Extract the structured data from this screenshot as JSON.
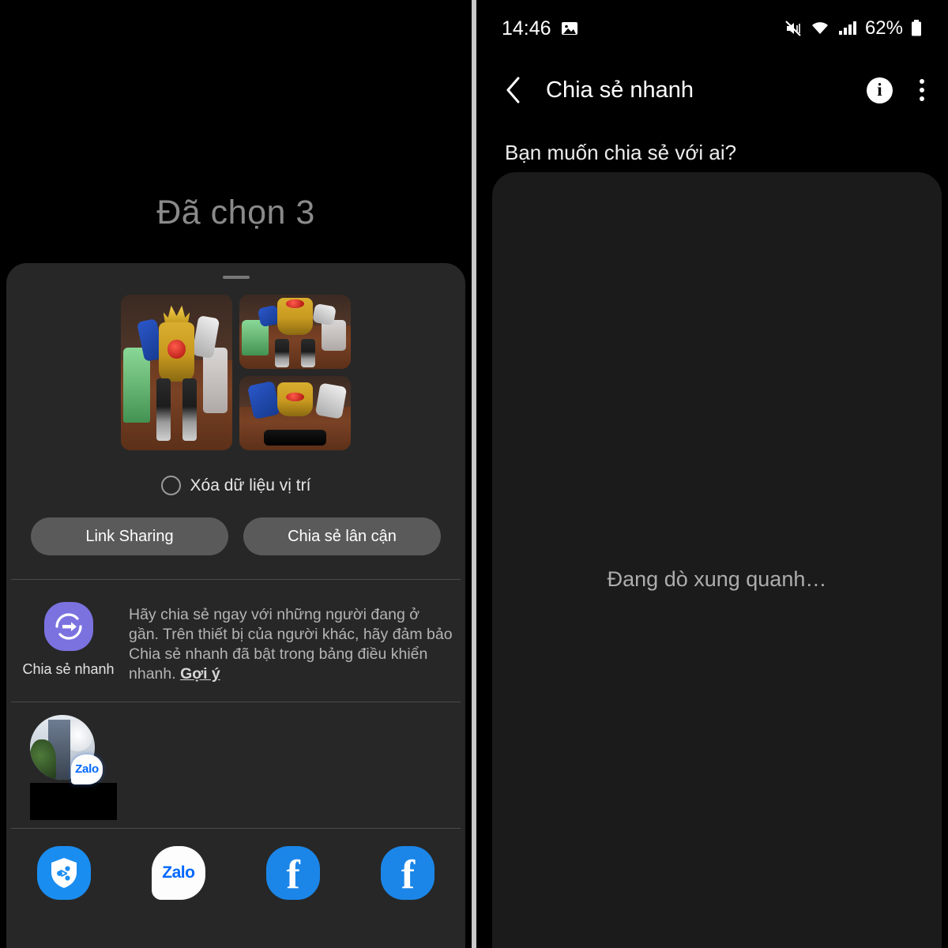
{
  "left_screen": {
    "selected_title": "Đã chọn 3",
    "thumbnails": [
      {
        "name": "robot-photo-1",
        "alt": "Toy robot figure full body on wooden floor"
      },
      {
        "name": "robot-photo-2",
        "alt": "Toy robot figure torso closeup"
      },
      {
        "name": "robot-photo-3",
        "alt": "Toy robot figure with blue and white arms"
      }
    ],
    "delete_location_label": "Xóa dữ liệu vị trí",
    "delete_location_checked": false,
    "buttons": {
      "link_sharing": "Link Sharing",
      "nearby_share": "Chia sẻ lân cận"
    },
    "quick_share": {
      "label": "Chia sẻ nhanh",
      "description": "Hãy chia sẻ ngay với những người đang ở gần. Trên thiết bị của người khác, hãy đảm bảo Chia sẻ nhanh đã bật trong bảng điều khiển nhanh. ",
      "link": "Gợi ý",
      "icon_color": "#7b72e0"
    },
    "contacts": [
      {
        "name": "contact-zalo",
        "badge": "Zalo",
        "label_redacted": true
      }
    ],
    "apps": [
      {
        "name": "quick-share-app",
        "label": "",
        "type": "shield-share",
        "color": "#1a8df0"
      },
      {
        "name": "zalo-app",
        "label": "Zalo",
        "type": "zalo",
        "color": "#ffffff"
      },
      {
        "name": "facebook-app-1",
        "label": "f",
        "type": "facebook",
        "color": "#1b86e8"
      },
      {
        "name": "facebook-app-2",
        "label": "f",
        "type": "facebook",
        "color": "#1b86e8"
      }
    ]
  },
  "right_screen": {
    "status_bar": {
      "time": "14:46",
      "battery_percent": "62%",
      "icons": [
        "image-icon",
        "mute-vibrate-icon",
        "wifi-icon",
        "signal-icon",
        "battery-icon"
      ]
    },
    "app_bar": {
      "title": "Chia sẻ nhanh",
      "back_label": "‹",
      "info_label": "i"
    },
    "question": "Bạn muốn chia sẻ với ai?",
    "searching_text": "Đang dò xung quanh…"
  }
}
